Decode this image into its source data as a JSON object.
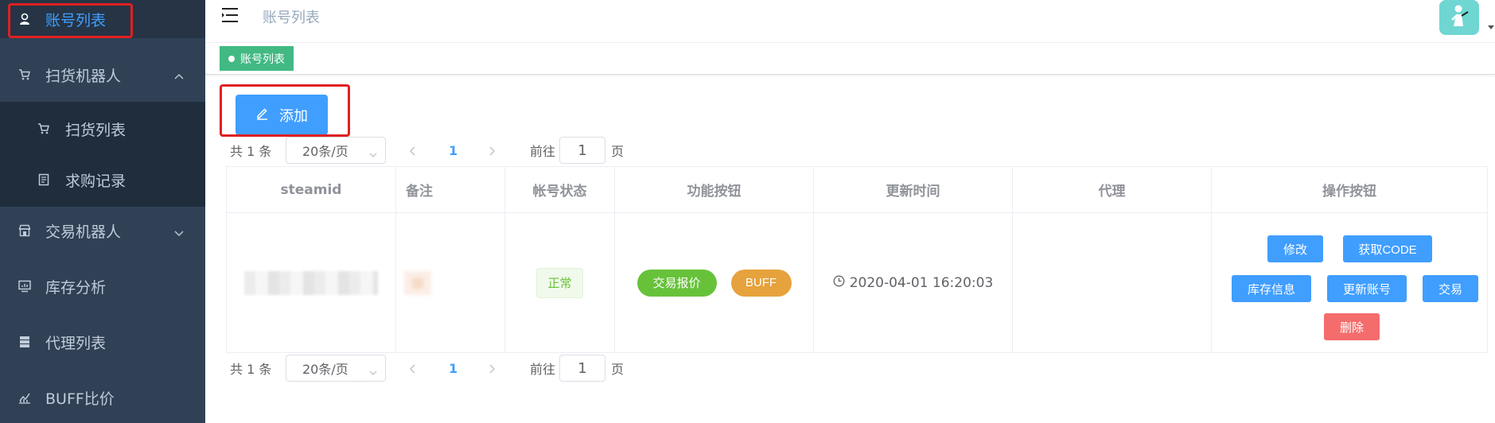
{
  "sidebar": {
    "items": [
      {
        "label": "账号列表",
        "icon": "user-icon",
        "active": true
      },
      {
        "label": "扫货机器人",
        "icon": "cart-icon",
        "expanded": true
      },
      {
        "label": "扫货列表",
        "icon": "cart-icon",
        "sub": true
      },
      {
        "label": "求购记录",
        "icon": "document-icon",
        "sub": true
      },
      {
        "label": "交易机器人",
        "icon": "shop-icon",
        "expanded": false
      },
      {
        "label": "库存分析",
        "icon": "monitor-icon"
      },
      {
        "label": "代理列表",
        "icon": "server-icon"
      },
      {
        "label": "BUFF比价",
        "icon": "chart-icon"
      }
    ]
  },
  "navbar": {
    "breadcrumb": "账号列表"
  },
  "tags": {
    "active": "账号列表"
  },
  "toolbar": {
    "add_label": "添加"
  },
  "pagination": {
    "total": "共 1 条",
    "page_size": "20条/页",
    "current_page": "1",
    "goto_label": "前往",
    "goto_value": "1",
    "page_suffix": "页"
  },
  "table": {
    "headers": [
      "steamid",
      "备注",
      "帐号状态",
      "功能按钮",
      "更新时间",
      "代理",
      "操作按钮"
    ],
    "rows": [
      {
        "status": "正常",
        "func_buttons": [
          "交易报价",
          "BUFF"
        ],
        "updated": "2020-04-01 16:20:03",
        "proxy": "",
        "actions": [
          "修改",
          "获取CODE",
          "库存信息",
          "更新账号",
          "交易",
          "删除"
        ]
      }
    ]
  },
  "colors": {
    "sidebar_bg": "#304156",
    "primary": "#409eff",
    "success": "#67c23a",
    "warning": "#e6a23c",
    "danger": "#f56c6c",
    "tag": "#42b983",
    "highlight": "#e02020"
  }
}
